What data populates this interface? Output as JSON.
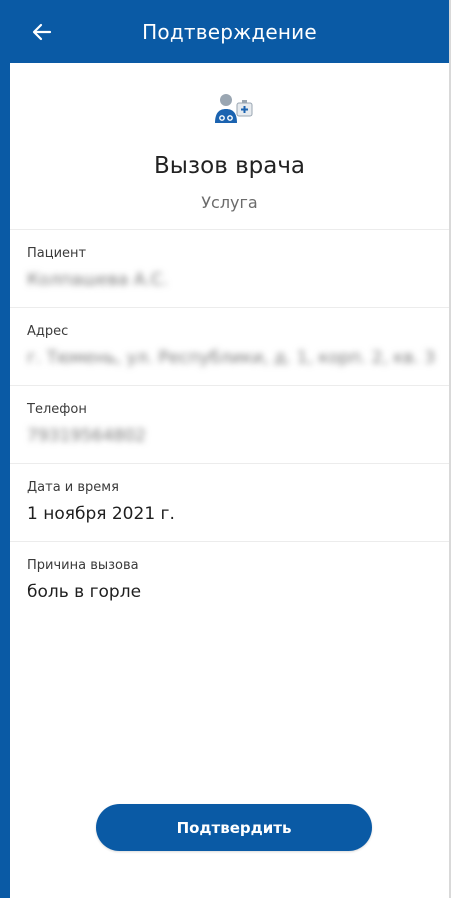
{
  "appbar": {
    "title": "Подтверждение",
    "back_icon": "arrow-left-icon"
  },
  "service": {
    "icon": "doctor-medkit-icon",
    "title": "Вызов врача",
    "subtitle": "Услуга"
  },
  "fields": [
    {
      "label": "Пациент",
      "value": "Колпашева А.С."
    },
    {
      "label": "Адрес",
      "value": "г. Тюмень, ул. Республики, д. 1, корп. 2, кв. 3"
    },
    {
      "label": "Телефон",
      "value": "79319564802"
    },
    {
      "label": "Дата и время",
      "value": "1 ноября 2021 г."
    },
    {
      "label": "Причина вызова",
      "value": "боль в горле"
    }
  ],
  "actions": {
    "confirm_label": "Подтвердить"
  },
  "colors": {
    "brand": "#0a5aa5",
    "background": "#ffffff"
  }
}
